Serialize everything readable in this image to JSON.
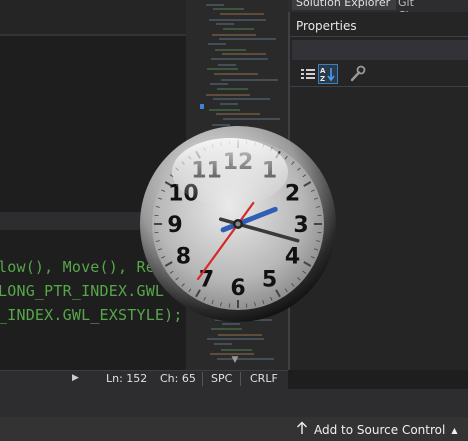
{
  "editor": {
    "code_lines": [
      "low(), Move(), Re",
      "LONG_PTR_INDEX.GWL",
      "_INDEX.GWL_EXSTYLE);"
    ]
  },
  "status_bar": {
    "line": "Ln: 152",
    "column": "Ch: 65",
    "whitespace": "SPC",
    "line_ending": "CRLF"
  },
  "properties_panel": {
    "tabs": [
      "Solution Explorer",
      "Git Changes"
    ],
    "title": "Properties",
    "toolbar_icons": [
      "categorized-icon",
      "alphabetical-icon",
      "property-pages-icon"
    ]
  },
  "footer": {
    "source_control_label": "Add to Source Control"
  },
  "clock": {
    "numerals": [
      "12",
      "1",
      "2",
      "3",
      "4",
      "5",
      "6",
      "7",
      "8",
      "9",
      "10",
      "11"
    ],
    "time": "2:17:36",
    "hour_hand_color": "#2f5fb5",
    "minute_hand_color": "#3a3a3a",
    "second_hand_color": "#d42a2a"
  },
  "colors": {
    "editor_bg": "#1e1e1e",
    "panel_bg": "#252526",
    "code_text": "#57a64a",
    "accent_blue": "#3c84d6"
  }
}
